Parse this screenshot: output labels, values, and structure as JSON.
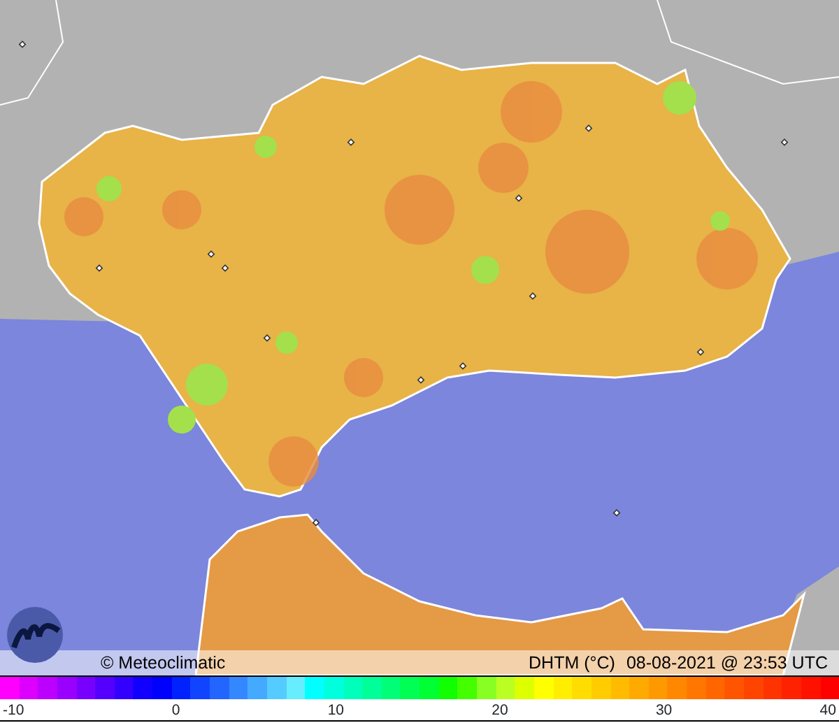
{
  "info_bar": {
    "credit": "© Meteoclimatic",
    "variable": "DHTM (°C)",
    "timestamp": "08-08-2021 @ 23:53 UTC"
  },
  "legend": {
    "ticks": [
      "-10",
      "0",
      "10",
      "20",
      "30",
      "40"
    ]
  }
}
